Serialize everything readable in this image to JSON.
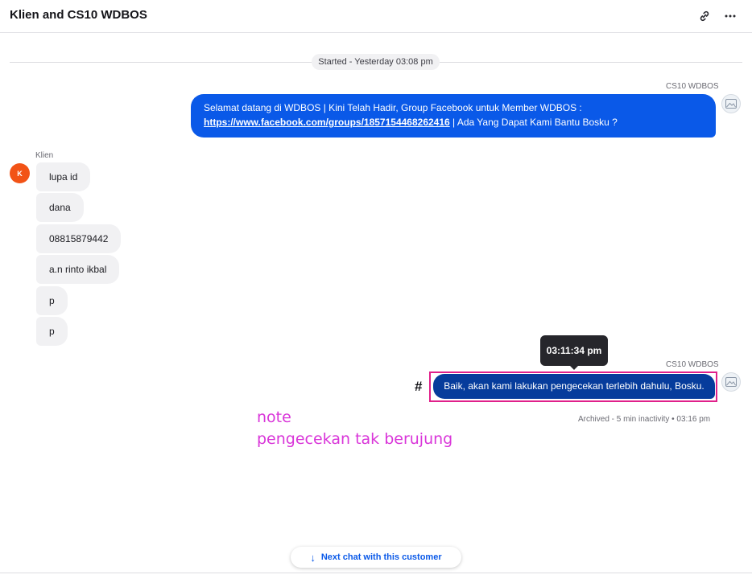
{
  "header": {
    "title": "Klien and CS10 WDBOS",
    "link_icon": "link-icon",
    "more_icon": "more-horizontal-icon"
  },
  "conversation": {
    "started": "Started - Yesterday 03:08 pm",
    "agent_name": "CS10 WDBOS",
    "client_name": "Klien",
    "client_initial": "K",
    "agent_message_1": {
      "text_before": "Selamat datang di WDBOS | Kini Telah Hadir, Group Facebook untuk Member WDBOS :",
      "link": "https://www.facebook.com/groups/1857154468262416",
      "text_after": "| Ada Yang Dapat Kami Bantu Bosku ?"
    },
    "client_messages": [
      "lupa id",
      "dana",
      "08815879442",
      "a.n rinto ikbal",
      "p",
      "p"
    ],
    "tooltip_time": "03:11:34 pm",
    "hash_mark": "#",
    "agent_message_2": "Baik, akan kami lakukan pengecekan terlebih dahulu, Bosku.",
    "archived": "Archived - 5 min inactivity • 03:16 pm"
  },
  "annotation": {
    "line1": "note",
    "line2": "pengecekan tak berujung",
    "color": "#d936d9",
    "highlight_color": "#e0208a"
  },
  "footer": {
    "next_chat_label": "Next chat with this customer"
  },
  "colors": {
    "agent_bubble": "#0a59e8",
    "agent_bubble_selected": "#063c9c",
    "client_bubble": "#f1f1f3",
    "client_avatar": "#f25316"
  }
}
